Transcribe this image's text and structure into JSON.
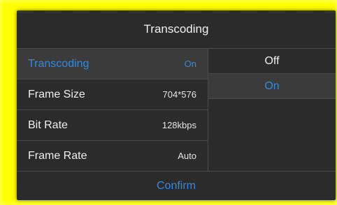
{
  "dialog": {
    "title": "Transcoding",
    "settings": [
      {
        "label": "Transcoding",
        "value": "On",
        "active": true
      },
      {
        "label": "Frame Size",
        "value": "704*576",
        "active": false
      },
      {
        "label": "Bit Rate",
        "value": "128kbps",
        "active": false
      },
      {
        "label": "Frame Rate",
        "value": "Auto",
        "active": false
      }
    ],
    "options": [
      {
        "label": "Off",
        "selected": false
      },
      {
        "label": "On",
        "selected": true
      }
    ],
    "confirm_label": "Confirm"
  },
  "colors": {
    "highlight_frame": "#ffff00",
    "dialog_bg": "#2b2b2b",
    "accent": "#2f89e6",
    "text": "#f0f0f0"
  }
}
